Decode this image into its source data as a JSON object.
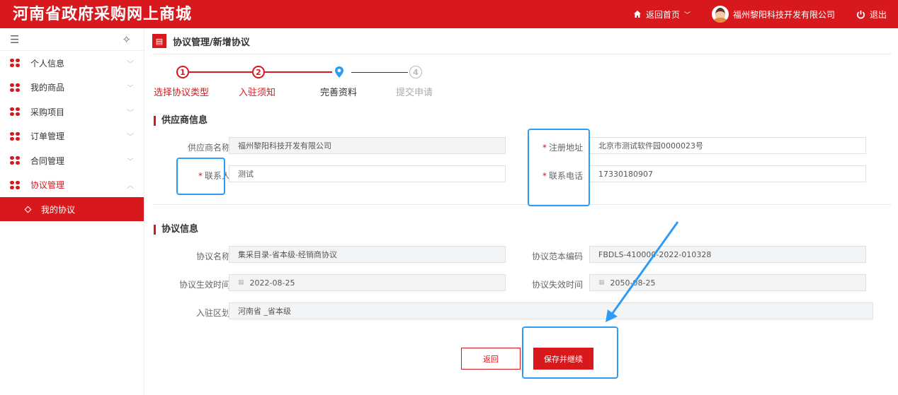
{
  "header": {
    "site_title": "河南省政府采购网上商城",
    "home_link": "返回首页",
    "company": "福州黎阳科技开发有限公司",
    "logout": "退出",
    "brand_color": "#d7191d"
  },
  "sidebar": {
    "items": [
      {
        "label": "个人信息"
      },
      {
        "label": "我的商品"
      },
      {
        "label": "采购项目"
      },
      {
        "label": "订单管理"
      },
      {
        "label": "合同管理"
      },
      {
        "label": "协议管理"
      }
    ],
    "sub_active": "我的协议"
  },
  "breadcrumb": "协议管理/新增协议",
  "steps": [
    {
      "num": "1",
      "label": "选择协议类型",
      "state": "done"
    },
    {
      "num": "2",
      "label": "入驻须知",
      "state": "done"
    },
    {
      "num": "",
      "label": "完善资料",
      "state": "current"
    },
    {
      "num": "4",
      "label": "提交申请",
      "state": "todo"
    }
  ],
  "supplier": {
    "section_title": "供应商信息",
    "name_label": "供应商名称",
    "name_value": "福州黎阳科技开发有限公司",
    "contact_label": "联系人",
    "contact_value": "测试",
    "address_label": "注册地址",
    "address_value": "北京市测试软件园0000023号",
    "phone_label": "联系电话",
    "phone_value": "17330180907"
  },
  "agreement": {
    "section_title": "协议信息",
    "name_label": "协议名称",
    "name_value": "集采目录-省本级-经销商协议",
    "code_label": "协议范本编码",
    "code_value": "FBDLS-410000-2022-010328",
    "start_label": "协议生效时间",
    "start_value": "2022-08-25",
    "end_label": "协议失效时间",
    "end_value": "2050-08-25",
    "region_label": "入驻区划",
    "region_value": "河南省 _省本级"
  },
  "buttons": {
    "back": "返回",
    "save": "保存并继续"
  },
  "annotation_color": "#2e9cf5"
}
